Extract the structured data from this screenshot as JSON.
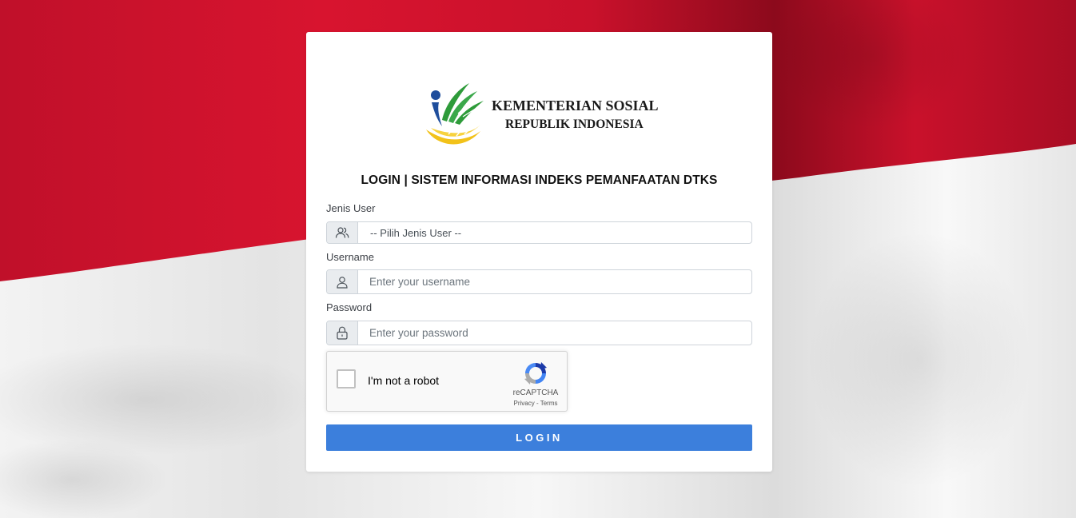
{
  "branding": {
    "org_name": "KEMENTERIAN SOSIAL",
    "org_sub": "REPUBLIK INDONESIA"
  },
  "page_title": "LOGIN | SISTEM INFORMASI INDEKS PEMANFAATAN DTKS",
  "form": {
    "user_type": {
      "label": "Jenis User",
      "selected": "-- Pilih Jenis User --",
      "icon": "users-icon"
    },
    "username": {
      "label": "Username",
      "placeholder": "Enter your username",
      "value": "",
      "icon": "user-icon"
    },
    "password": {
      "label": "Password",
      "placeholder": "Enter your password",
      "value": "",
      "icon": "lock-icon"
    },
    "recaptcha": {
      "label": "I'm not a robot",
      "brand": "reCAPTCHA",
      "privacy": "Privacy",
      "separator": " - ",
      "terms": "Terms",
      "checked": false
    },
    "submit_label": "LOGIN"
  },
  "colors": {
    "flag_red": "#c8102e",
    "flag_white": "#f4f4f4",
    "button": "#3c7fdc",
    "logo_green": "#2e9b3a",
    "logo_yellow": "#f2c21a",
    "logo_blue": "#1f4e9c"
  }
}
